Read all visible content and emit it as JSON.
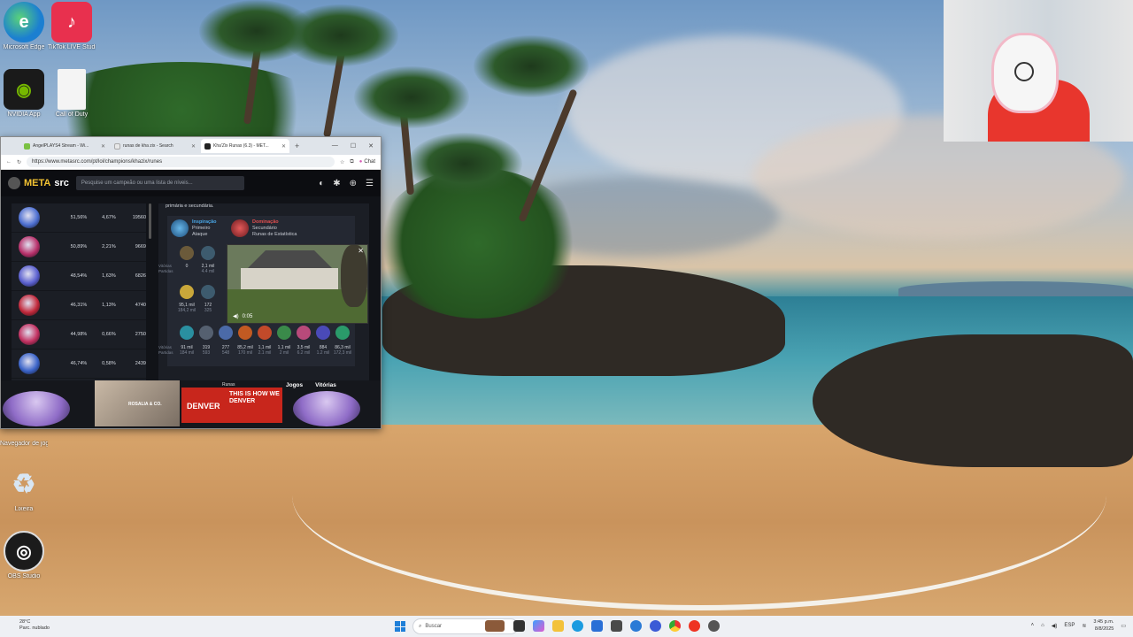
{
  "desktop": {
    "icons": [
      {
        "label": "Microsoft Edge",
        "icon": "edge-icon",
        "color": "#1b7fd1"
      },
      {
        "label": "TikTok LIVE Studio",
        "icon": "tiktok-icon",
        "color": "#e8304e"
      },
      {
        "label": "NVIDIA App",
        "icon": "nvidia-icon",
        "color": "#1a1a1a"
      },
      {
        "label": "Call of Duty",
        "icon": "file-icon",
        "color": "#f4f4f4"
      },
      {
        "label": "Navegador de jogos",
        "icon": "globe-icon",
        "color": "#3b6fd6"
      },
      {
        "label": "Lixeira",
        "icon": "recycle-bin-icon",
        "color": "#d8e6f3"
      },
      {
        "label": "OBS Studio",
        "icon": "obs-icon",
        "color": "#1b1b1b"
      }
    ]
  },
  "browser": {
    "tabs": [
      {
        "title": "AngelPLAYS4 Stream - Wi...",
        "active": false,
        "color": "#7ac143"
      },
      {
        "title": "runas de kha zix - Search",
        "active": false,
        "color": "#e8e8e8"
      },
      {
        "title": "Kha'Zix Runas (6.3) - MET...",
        "active": true,
        "color": "#222222"
      }
    ],
    "new_tab": "+",
    "url": "https://www.metasrc.com/pt/lol/champions/khazix/runes",
    "chat_label": "Chat"
  },
  "metasrc": {
    "brand_meta": "META",
    "brand_src": "src",
    "search_placeholder": "Pesquise um campeão ou uma lista de níveis...",
    "hint": "primária e secundária.",
    "rows": [
      {
        "win": "51,56%",
        "pick": "4,67%",
        "games": "19560",
        "color": "#4d6fd1"
      },
      {
        "win": "50,89%",
        "pick": "2,21%",
        "games": "9669",
        "color": "#b8306a"
      },
      {
        "win": "48,54%",
        "pick": "1,63%",
        "games": "6826",
        "color": "#5a5fcf"
      },
      {
        "win": "46,31%",
        "pick": "1,13%",
        "games": "4740",
        "color": "#c2283a"
      },
      {
        "win": "44,98%",
        "pick": "0,66%",
        "games": "2750",
        "color": "#c23060"
      },
      {
        "win": "46,74%",
        "pick": "0,58%",
        "games": "2439",
        "color": "#3a63c8"
      },
      {
        "win": "49,87%",
        "pick": "",
        "games": "",
        "color": "#3a5bb0"
      }
    ],
    "primary_tree": {
      "name": "Inspiração",
      "line1": "Primeiro",
      "line2": "Ataque",
      "color": "#2c7cc9"
    },
    "secondary_tree": {
      "name": "Dominação",
      "line1": "Secundário",
      "line2": "Runas de Estatística",
      "color": "#c8323a"
    },
    "stats_row1": [
      {
        "top": "0",
        "bottom": ""
      },
      {
        "top": "2,1 mil",
        "bottom": "4.4 mil"
      }
    ],
    "stats_row2": [
      {
        "top": "95,1 mil",
        "bottom": "184,2 mil"
      },
      {
        "top": "172",
        "bottom": "325"
      }
    ],
    "stats_row3": [
      {
        "top": "91 mil",
        "bottom": "184 mil"
      },
      {
        "top": "319",
        "bottom": "593"
      },
      {
        "top": "277",
        "bottom": "548"
      },
      {
        "top": "85,2 mil",
        "bottom": "170 mil"
      },
      {
        "top": "1,1 mil",
        "bottom": "2.1 mil"
      },
      {
        "top": "1,1 mil",
        "bottom": "2 mil"
      },
      {
        "top": "3,5 mil",
        "bottom": "6.2 mil"
      },
      {
        "top": "884",
        "bottom": "1.2 mil"
      },
      {
        "top": "86,3 mil",
        "bottom": "172,3 mil"
      }
    ],
    "label_vitorias": "Vitórias",
    "label_partidas": "Partidas",
    "video_time": "0:05",
    "tab_jogos": "Jogos",
    "tab_vitorias": "Vitórias",
    "rosa_label": "Runas",
    "ad_rosalia": "ROSALIA & CO.",
    "ad_denver_small": "DENVER",
    "ad_denver_big": "THIS IS HOW WE DENVER"
  },
  "taskbar": {
    "weather_temp": "28°C",
    "weather_desc": "Parc. nublado",
    "search_placeholder": "Buscar",
    "time": "3:45 p.m.",
    "date": "8/8/2025",
    "lang": "ESP"
  }
}
